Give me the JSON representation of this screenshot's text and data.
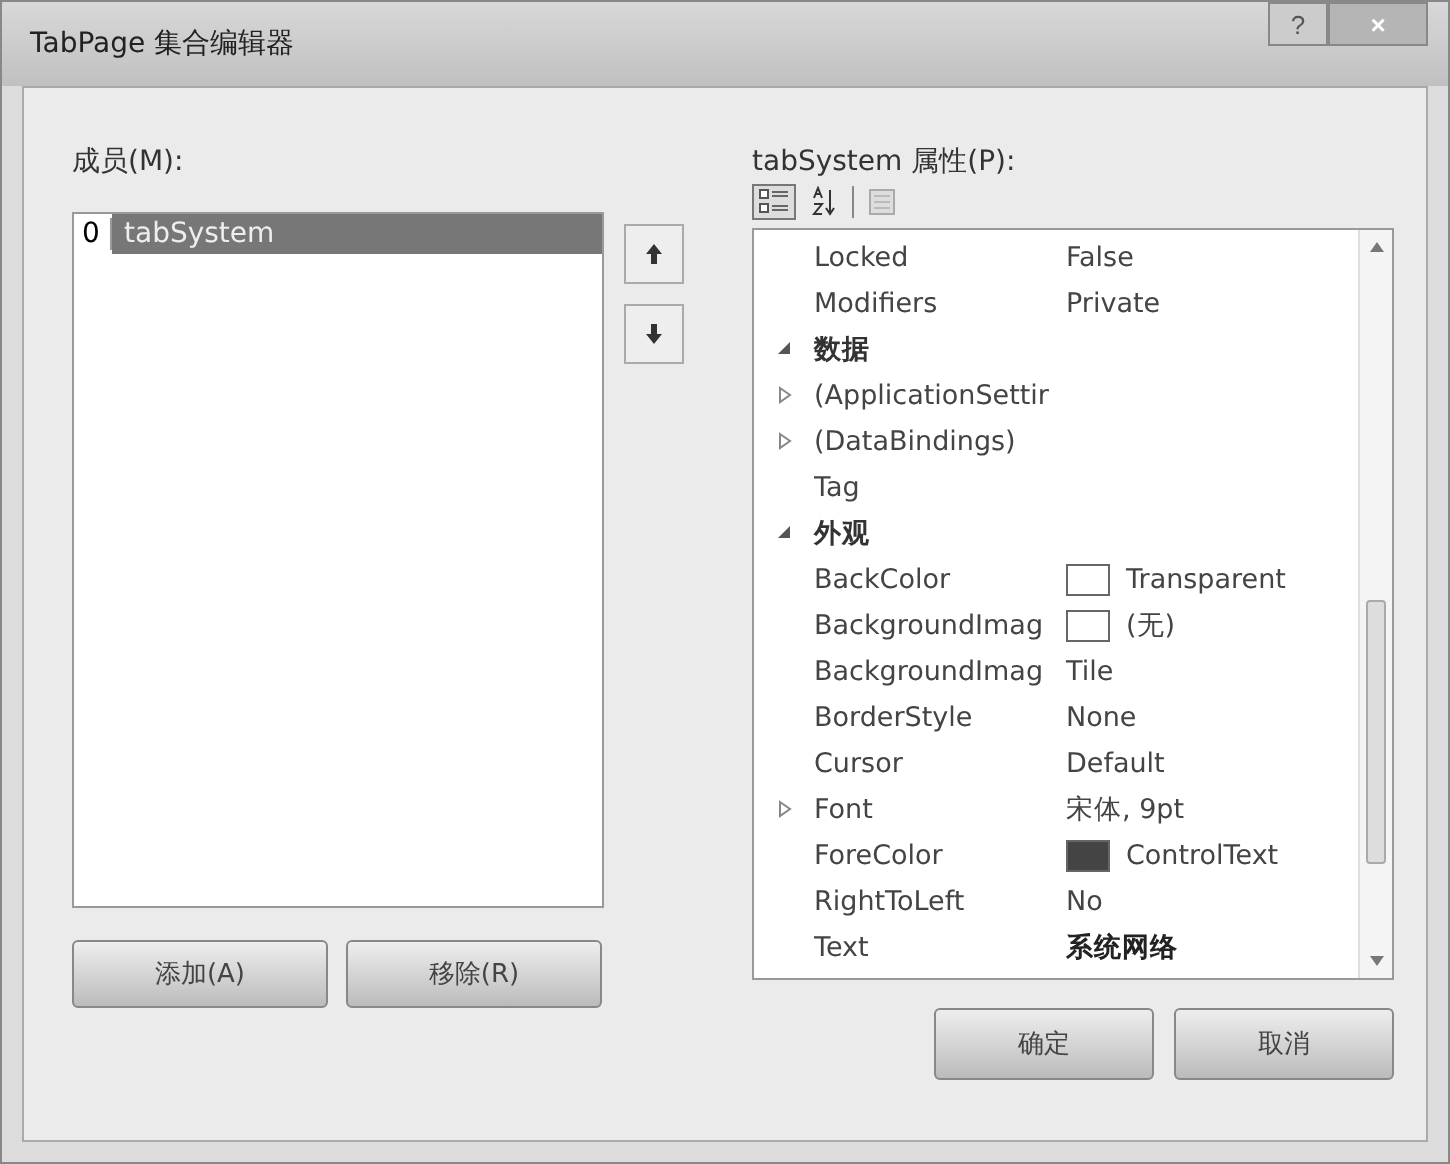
{
  "window": {
    "title": "TabPage 集合编辑器",
    "help": "?",
    "close": "×"
  },
  "members": {
    "label": "成员(M):",
    "items": [
      {
        "index": "0",
        "name": "tabSystem",
        "selected": true
      }
    ]
  },
  "properties": {
    "label": "tabSystem 属性(P):",
    "view_buttons": [
      {
        "kind": "categorized",
        "selected": true
      },
      {
        "kind": "alphabetical",
        "selected": false
      }
    ],
    "rows": [
      {
        "kind": "prop",
        "name": "Locked",
        "value": "False",
        "modified": false
      },
      {
        "kind": "prop",
        "name": "Modifiers",
        "value": "Private",
        "modified": false
      },
      {
        "kind": "category",
        "name": "数据",
        "expanded": true
      },
      {
        "kind": "prop",
        "name": "(ApplicationSettir",
        "expanded": false
      },
      {
        "kind": "prop",
        "name": "(DataBindings)",
        "expanded": false
      },
      {
        "kind": "prop",
        "name": "Tag"
      },
      {
        "kind": "category",
        "name": "外观",
        "expanded": true
      },
      {
        "kind": "prop",
        "name": "BackColor",
        "value": "Transparent",
        "color": "#ffffff",
        "modified": false
      },
      {
        "kind": "prop",
        "name": "BackgroundImag",
        "value": "(无)",
        "color": "#ffffff",
        "modified": false
      },
      {
        "kind": "prop",
        "name": "BackgroundImag",
        "value": "Tile",
        "modified": false
      },
      {
        "kind": "prop",
        "name": "BorderStyle",
        "value": "None",
        "modified": false
      },
      {
        "kind": "prop",
        "name": "Cursor",
        "value": "Default",
        "modified": false
      },
      {
        "kind": "prop",
        "name": "Font",
        "value": "宋体, 9pt",
        "expanded": false,
        "modified": false
      },
      {
        "kind": "prop",
        "name": "ForeColor",
        "value": "ControlText",
        "color": "#444444",
        "modified": false
      },
      {
        "kind": "prop",
        "name": "RightToLeft",
        "value": "No",
        "modified": false
      },
      {
        "kind": "prop",
        "name": "Text",
        "value": "系统网络",
        "modified": true
      }
    ]
  },
  "list_buttons": [
    "添加(A)",
    "移除(R)"
  ],
  "dialog_buttons": [
    "确定",
    "取消"
  ]
}
